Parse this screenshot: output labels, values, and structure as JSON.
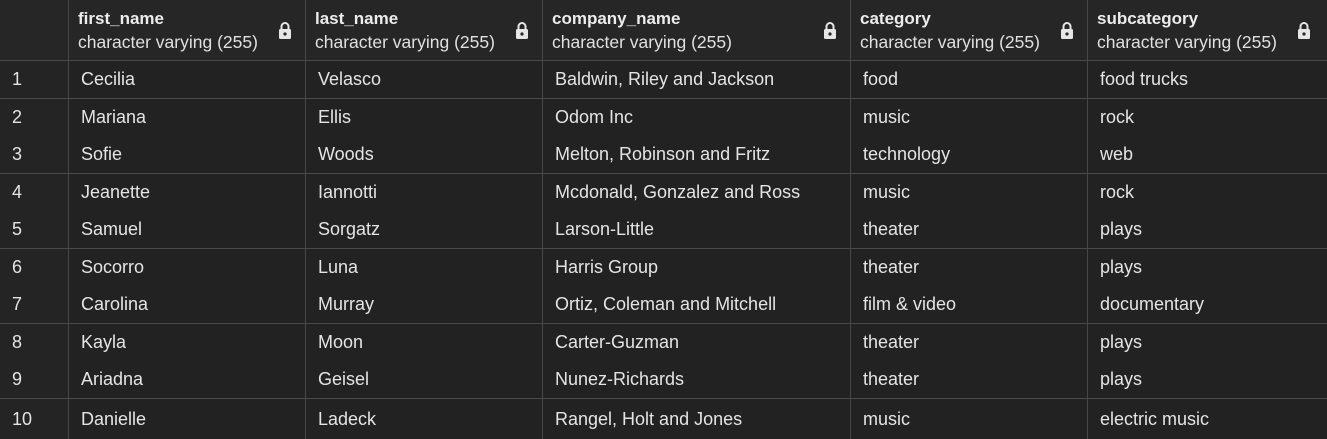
{
  "columns": [
    {
      "name": "first_name",
      "type": "character varying (255)"
    },
    {
      "name": "last_name",
      "type": "character varying (255)"
    },
    {
      "name": "company_name",
      "type": "character varying (255)"
    },
    {
      "name": "category",
      "type": "character varying (255)"
    },
    {
      "name": "subcategory",
      "type": "character varying (255)"
    }
  ],
  "rows": [
    {
      "num": "1",
      "cells": [
        "Cecilia",
        "Velasco",
        "Baldwin, Riley and Jackson",
        "food",
        "food trucks"
      ]
    },
    {
      "num": "2",
      "cells": [
        "Mariana",
        "Ellis",
        "Odom Inc",
        "music",
        "rock"
      ]
    },
    {
      "num": "3",
      "cells": [
        "Sofie",
        "Woods",
        "Melton, Robinson and Fritz",
        "technology",
        "web"
      ]
    },
    {
      "num": "4",
      "cells": [
        "Jeanette",
        "Iannotti",
        "Mcdonald, Gonzalez and Ross",
        "music",
        "rock"
      ]
    },
    {
      "num": "5",
      "cells": [
        "Samuel",
        "Sorgatz",
        "Larson-Little",
        "theater",
        "plays"
      ]
    },
    {
      "num": "6",
      "cells": [
        "Socorro",
        "Luna",
        "Harris Group",
        "theater",
        "plays"
      ]
    },
    {
      "num": "7",
      "cells": [
        "Carolina",
        "Murray",
        "Ortiz, Coleman and Mitchell",
        "film & video",
        "documentary"
      ]
    },
    {
      "num": "8",
      "cells": [
        "Kayla",
        "Moon",
        "Carter-Guzman",
        "theater",
        "plays"
      ]
    },
    {
      "num": "9",
      "cells": [
        "Ariadna",
        "Geisel",
        "Nunez-Richards",
        "theater",
        "plays"
      ]
    },
    {
      "num": "10",
      "cells": [
        "Danielle",
        "Ladeck",
        "Rangel, Holt and Jones",
        "music",
        "electric music"
      ]
    }
  ],
  "colors": {
    "background": "#222222",
    "header_background": "#262626",
    "grid_line": "#474747",
    "text": "#e4e4e4"
  },
  "icons": {
    "column_lock": "lock-icon"
  }
}
